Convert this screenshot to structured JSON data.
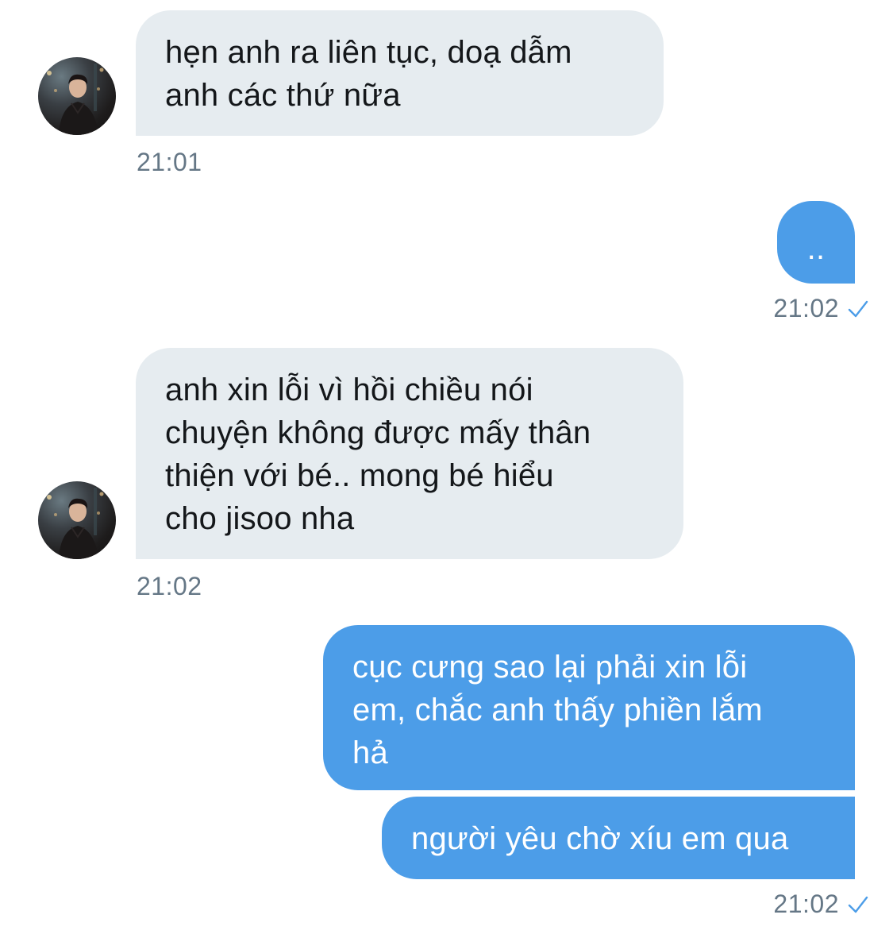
{
  "messages": [
    {
      "direction": "incoming",
      "text": "hẹn anh ra liên tục, doạ dẫm\nanh các thứ nữa",
      "time": "21:01"
    },
    {
      "direction": "outgoing",
      "text": "..",
      "time": "21:02"
    },
    {
      "direction": "incoming",
      "text": "anh xin lỗi vì hồi chiều nói\nchuyện không được mấy thân\nthiện với bé.. mong bé hiểu\ncho jisoo nha",
      "time": "21:02"
    },
    {
      "direction": "outgoing",
      "text": "cục cưng sao lại phải xin lỗi\nem, chắc anh thấy phiền lắm\nhả"
    },
    {
      "direction": "outgoing",
      "text": "người yêu chờ xíu em qua",
      "time": "21:02"
    }
  ],
  "icons": {
    "avatar": "avatar-photo",
    "read_receipt": "checkmark-icon"
  },
  "colors": {
    "incoming_bubble": "#e6ecf0",
    "outgoing_bubble": "#4c9de8",
    "timestamp": "#657786",
    "checkmark": "#4c9de8"
  }
}
